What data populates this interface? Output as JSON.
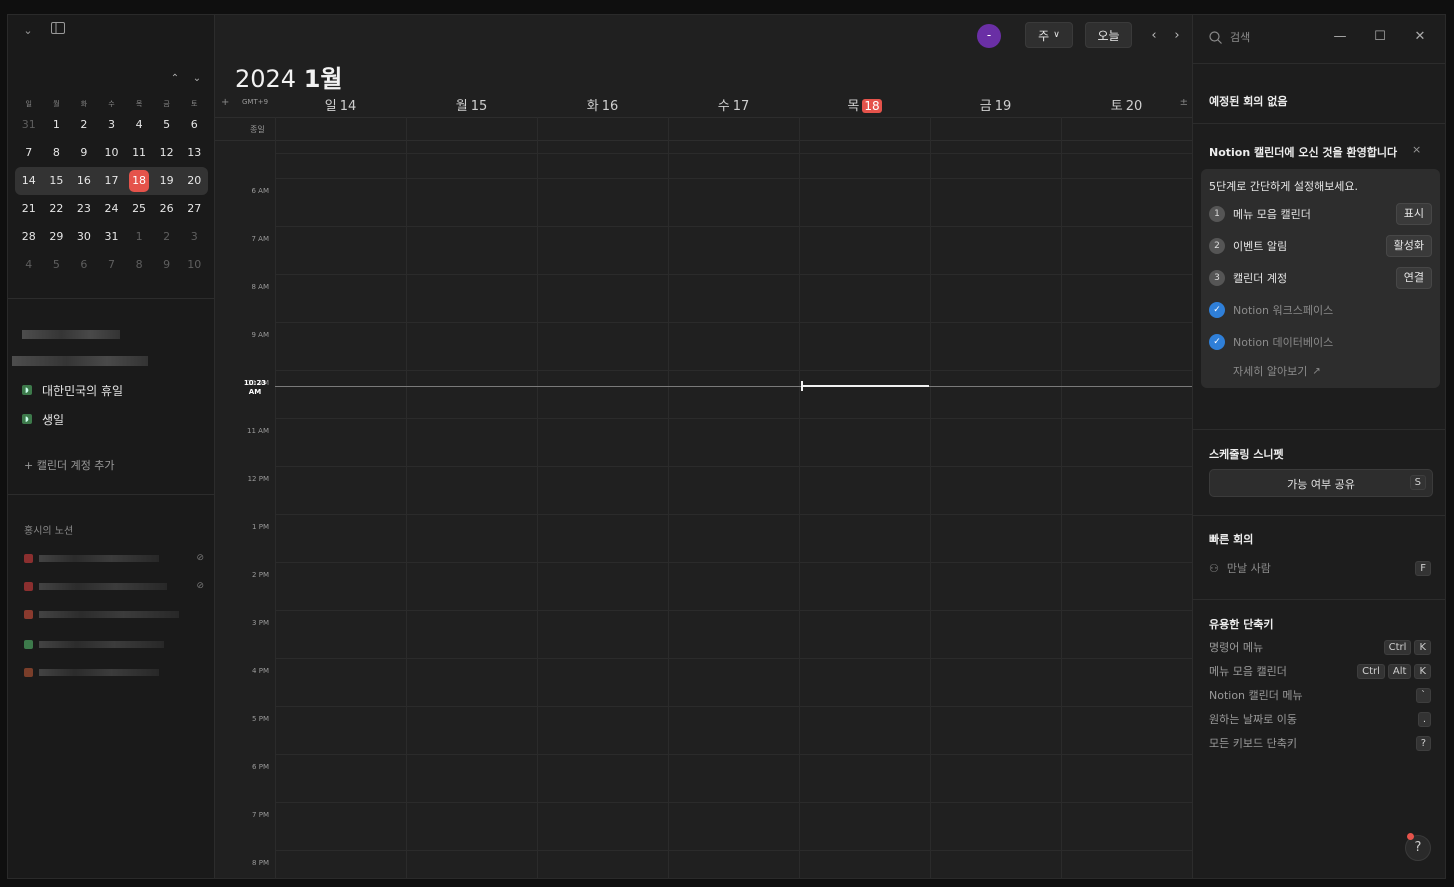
{
  "sidebar": {
    "weekday_headers": [
      "일",
      "월",
      "화",
      "수",
      "목",
      "금",
      "토"
    ],
    "mini_calendar_weeks": [
      [
        {
          "d": "31",
          "dim": true
        },
        {
          "d": "1"
        },
        {
          "d": "2"
        },
        {
          "d": "3"
        },
        {
          "d": "4"
        },
        {
          "d": "5"
        },
        {
          "d": "6"
        }
      ],
      [
        {
          "d": "7"
        },
        {
          "d": "8"
        },
        {
          "d": "9"
        },
        {
          "d": "10"
        },
        {
          "d": "11"
        },
        {
          "d": "12"
        },
        {
          "d": "13"
        }
      ],
      [
        {
          "d": "14"
        },
        {
          "d": "15"
        },
        {
          "d": "16"
        },
        {
          "d": "17"
        },
        {
          "d": "18",
          "today": true
        },
        {
          "d": "19"
        },
        {
          "d": "20"
        }
      ],
      [
        {
          "d": "21"
        },
        {
          "d": "22"
        },
        {
          "d": "23"
        },
        {
          "d": "24"
        },
        {
          "d": "25"
        },
        {
          "d": "26"
        },
        {
          "d": "27"
        }
      ],
      [
        {
          "d": "28"
        },
        {
          "d": "29"
        },
        {
          "d": "30"
        },
        {
          "d": "31"
        },
        {
          "d": "1",
          "dim": true
        },
        {
          "d": "2",
          "dim": true
        },
        {
          "d": "3",
          "dim": true
        }
      ],
      [
        {
          "d": "4",
          "dim": true
        },
        {
          "d": "5",
          "dim": true
        },
        {
          "d": "6",
          "dim": true
        },
        {
          "d": "7",
          "dim": true
        },
        {
          "d": "8",
          "dim": true
        },
        {
          "d": "9",
          "dim": true
        },
        {
          "d": "10",
          "dim": true
        }
      ]
    ],
    "calendars": [
      "대한민국의 휴일",
      "생일"
    ],
    "add_calendar": "+ 캘린더 계정 추가",
    "workspace_title": "홍시의 노션",
    "workspace_colors": [
      "#8b2f2f",
      "#8b2f2f",
      "#8a3a2e",
      "#3d7a4b",
      "#7a3e2a"
    ]
  },
  "main": {
    "avatar_initial": "-",
    "view_label": "주",
    "today_label": "오늘",
    "year": "2024",
    "month": "1월",
    "timezone": "GMT+9",
    "days": [
      {
        "dow": "일",
        "num": "14"
      },
      {
        "dow": "월",
        "num": "15"
      },
      {
        "dow": "화",
        "num": "16"
      },
      {
        "dow": "수",
        "num": "17"
      },
      {
        "dow": "목",
        "num": "18",
        "today": true
      },
      {
        "dow": "금",
        "num": "19"
      },
      {
        "dow": "토",
        "num": "20"
      }
    ],
    "allday_label": "종일",
    "hours": [
      "6 AM",
      "7 AM",
      "8 AM",
      "9 AM",
      "10 AM",
      "11 AM",
      "12 PM",
      "1 PM",
      "2 PM",
      "3 PM",
      "4 PM",
      "5 PM",
      "6 PM",
      "7 PM",
      "8 PM"
    ],
    "now_time": "10:23 AM",
    "today_color": "#e5534b"
  },
  "right": {
    "search_placeholder": "검색",
    "no_meetings": "예정된 회의 없음",
    "welcome": "Notion 캘린더에 오신 것을 환영합니다",
    "setup_intro": "5단계로 간단하게 설정해보세요.",
    "steps": [
      {
        "num": "1",
        "label": "메뉴 모음 캘린더",
        "action": "표시"
      },
      {
        "num": "2",
        "label": "이벤트 알림",
        "action": "활성화"
      },
      {
        "num": "3",
        "label": "캘린더 계정",
        "action": "연결"
      }
    ],
    "done_steps": [
      "Notion 워크스페이스",
      "Notion 데이터베이스"
    ],
    "learn_more": "자세히 알아보기",
    "scheduling_title": "스케줄링 스니펫",
    "share_availability": "가능 여부 공유",
    "share_key": "S",
    "quick_meeting_title": "빠른 회의",
    "meet_placeholder": "만날 사람",
    "meet_key": "F",
    "shortcuts_title": "유용한 단축키",
    "shortcuts": [
      {
        "label": "명령어 메뉴",
        "keys": [
          "Ctrl",
          "K"
        ]
      },
      {
        "label": "메뉴 모음 캘린더",
        "keys": [
          "Ctrl",
          "Alt",
          "K"
        ]
      },
      {
        "label": "Notion 캘린더 메뉴",
        "keys": [
          "`"
        ]
      },
      {
        "label": "원하는 날짜로 이동",
        "keys": [
          "."
        ]
      },
      {
        "label": "모든 키보드 단축키",
        "keys": [
          "?"
        ]
      }
    ],
    "help_label": "?"
  }
}
